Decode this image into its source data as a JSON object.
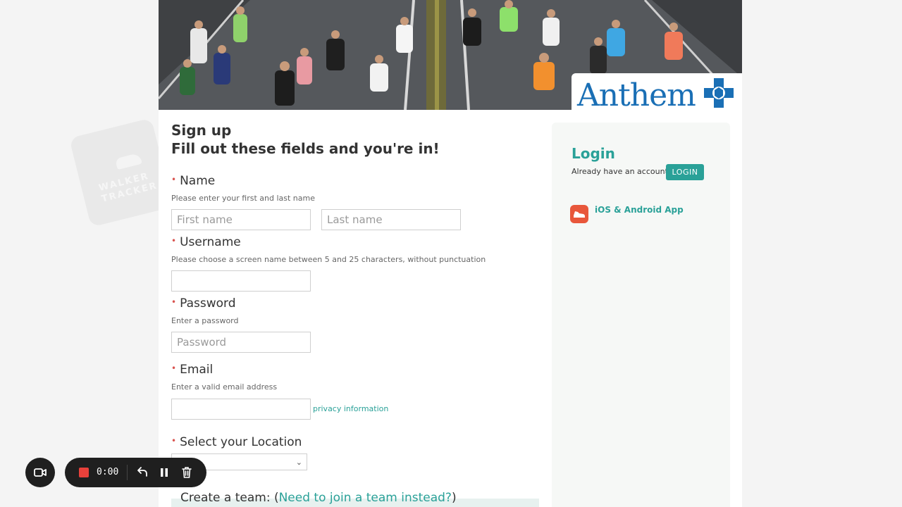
{
  "banner": {
    "brand_name": "Anthem",
    "brand_color": "#1a6fb5"
  },
  "watermark": {
    "line1": "WALKER",
    "line2": "TRACKER"
  },
  "form": {
    "heading_line1": "Sign up",
    "heading_line2": "Fill out these fields and you're in!",
    "required_marker": "•",
    "name": {
      "label": "Name",
      "hint": "Please enter your first and last name",
      "first_placeholder": "First name",
      "last_placeholder": "Last name"
    },
    "username": {
      "label": "Username",
      "hint": "Please choose a screen name between 5 and 25 characters, without punctuation",
      "value": ""
    },
    "password": {
      "label": "Password",
      "hint": "Enter a password",
      "placeholder": "Password"
    },
    "email": {
      "label": "Email",
      "hint": "Enter a valid email address",
      "value": "",
      "privacy_link": "privacy information"
    },
    "location": {
      "label": "Select your Location",
      "selected": ""
    },
    "team": {
      "label_prefix": "Create a team: (",
      "link": "Need to join a team instead?",
      "label_suffix": ")"
    }
  },
  "sidebar": {
    "login_title": "Login",
    "login_prompt": "Already have an account?",
    "login_button": "LOGIN",
    "app_link": "iOS & Android App",
    "accent_color": "#2aa198"
  },
  "recorder": {
    "time": "0:00",
    "icons": [
      "camera-icon",
      "stop-icon",
      "undo-icon",
      "pause-icon",
      "trash-icon"
    ]
  }
}
